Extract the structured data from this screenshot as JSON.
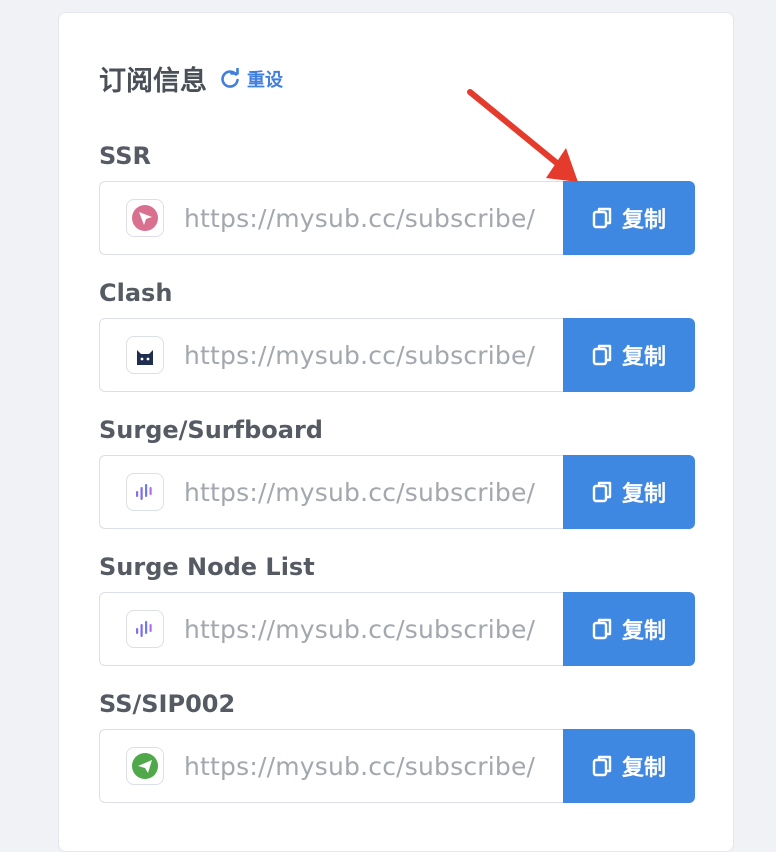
{
  "card": {
    "title": "订阅信息",
    "reset_label": "重设"
  },
  "subscriptions": [
    {
      "label": "SSR",
      "url": "https://mysub.cc/subscribe/",
      "icon": "ssr-app-icon",
      "copy_label": "复制"
    },
    {
      "label": "Clash",
      "url": "https://mysub.cc/subscribe/",
      "icon": "clash-cat-icon",
      "copy_label": "复制"
    },
    {
      "label": "Surge/Surfboard",
      "url": "https://mysub.cc/subscribe/",
      "icon": "surge-wave-icon",
      "copy_label": "复制"
    },
    {
      "label": "Surge Node List",
      "url": "https://mysub.cc/subscribe/",
      "icon": "surge-wave-icon",
      "copy_label": "复制"
    },
    {
      "label": "SS/SIP002",
      "url": "https://mysub.cc/subscribe/",
      "icon": "shadowsocks-plane-icon",
      "copy_label": "复制"
    }
  ],
  "colors": {
    "accent": "#3f88e2",
    "link": "#3f7fe0",
    "annotation_arrow": "#e53b2c"
  }
}
